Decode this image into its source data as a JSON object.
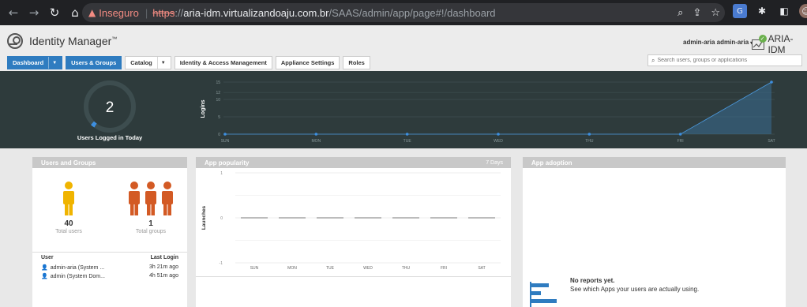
{
  "browser": {
    "security_label": "Inseguro",
    "url_protocol": "https",
    "url_sep": "://",
    "url_host": "aria-idm.virtualizandoaju.com.br",
    "url_path": "/SAAS/admin/app/page#!/dashboard"
  },
  "app": {
    "title": "Identity Manager",
    "trademark": "™",
    "user_menu": "admin-aria admin-aria",
    "tenant": "ARIA-IDM"
  },
  "tabs": [
    {
      "label": "Dashboard"
    },
    {
      "label": "Users & Groups"
    },
    {
      "label": "Catalog"
    },
    {
      "label": "Identity & Access Management"
    },
    {
      "label": "Appliance Settings"
    },
    {
      "label": "Roles"
    }
  ],
  "search": {
    "placeholder": "Search users, groups or applications"
  },
  "banner": {
    "logged_in_count": "2",
    "logged_in_label": "Users Logged in Today"
  },
  "chart_data": [
    {
      "type": "area",
      "ylabel": "Logins",
      "categories": [
        "SUN",
        "MON",
        "TUE",
        "WED",
        "THU",
        "FRI",
        "SAT"
      ],
      "values": [
        0,
        0,
        0,
        0,
        0,
        0,
        15
      ],
      "yticks": [
        "15",
        "12",
        "10",
        "5",
        "0"
      ],
      "ylim": [
        0,
        15
      ],
      "grid": true
    },
    {
      "type": "line",
      "title": "App popularity",
      "subtitle": "7 Days",
      "ylabel": "Launches",
      "categories": [
        "SUN",
        "MON",
        "TUE",
        "WED",
        "THU",
        "FRI",
        "SAT"
      ],
      "values": [
        0,
        0,
        0,
        0,
        0,
        0,
        0
      ],
      "yticks": [
        "1",
        "0",
        "-1"
      ],
      "ylim": [
        -1,
        1
      ],
      "grid": true
    }
  ],
  "users_groups": {
    "title": "Users and Groups",
    "total_users": "40",
    "total_users_label": "Total users",
    "total_groups": "1",
    "total_groups_label": "Total groups",
    "col_user": "User",
    "col_last_login": "Last Login",
    "rows": [
      {
        "name": "admin-aria (System ...",
        "last": "3h 21m ago"
      },
      {
        "name": "admin (System Dom...",
        "last": "4h 51m ago"
      }
    ]
  },
  "app_adoption": {
    "title": "App adoption",
    "empty_title": "No reports yet.",
    "empty_desc": "See which Apps your users are actually using."
  },
  "colors": {
    "accent": "#2f7cc0",
    "banner_bg": "#2e3b3c",
    "user_icon": "#f0b400",
    "group_icon": "#d35a24",
    "chart_point": "#3d8fe0"
  }
}
